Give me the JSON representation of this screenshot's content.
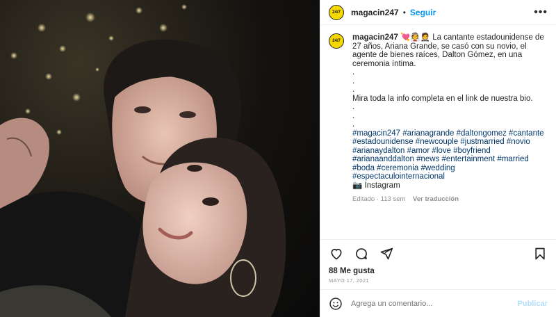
{
  "post": {
    "username": "magacin247",
    "follow_label": "Seguir",
    "more_label": "•••",
    "avatar_text": "24/7"
  },
  "caption": {
    "username": "magacin247",
    "emojis": "💘👰🤵",
    "lines": [
      "La cantante estadounidense de 27 años, Ariana Grande, se casó con su novio, el agente de bienes raíces, Dalton Gómez, en una ceremonia íntima.",
      ".",
      ".",
      ".",
      "Mira toda la info completa en el link de nuestra bio.",
      ".",
      ".",
      "."
    ],
    "hashtags": "#magacin247 #arianagrande #daltongomez #cantante #estadounidense #newcouple #justmarried #novio #arianaydalton #amor #love #boyfriend #arianaanddalton #news #entertainment #married #boda #ceremonia #wedding #espectaculointernacional",
    "source": "📷 Instagram",
    "edited": "Editado · 113 sem",
    "translate_label": "Ver traducción"
  },
  "likes": "88 Me gusta",
  "date": "MAYO 17, 2021",
  "comment": {
    "placeholder": "Agrega un comentario...",
    "publish_label": "Publicar"
  },
  "icons": {
    "like": "heart-icon",
    "comment": "comment-icon",
    "share": "share-icon",
    "save": "bookmark-icon",
    "emoji": "emoji-icon"
  },
  "colors": {
    "accent": "#0095f6",
    "hashtag": "#00376b",
    "avatar_bg": "#f5d800",
    "muted": "#8e8e8e"
  }
}
